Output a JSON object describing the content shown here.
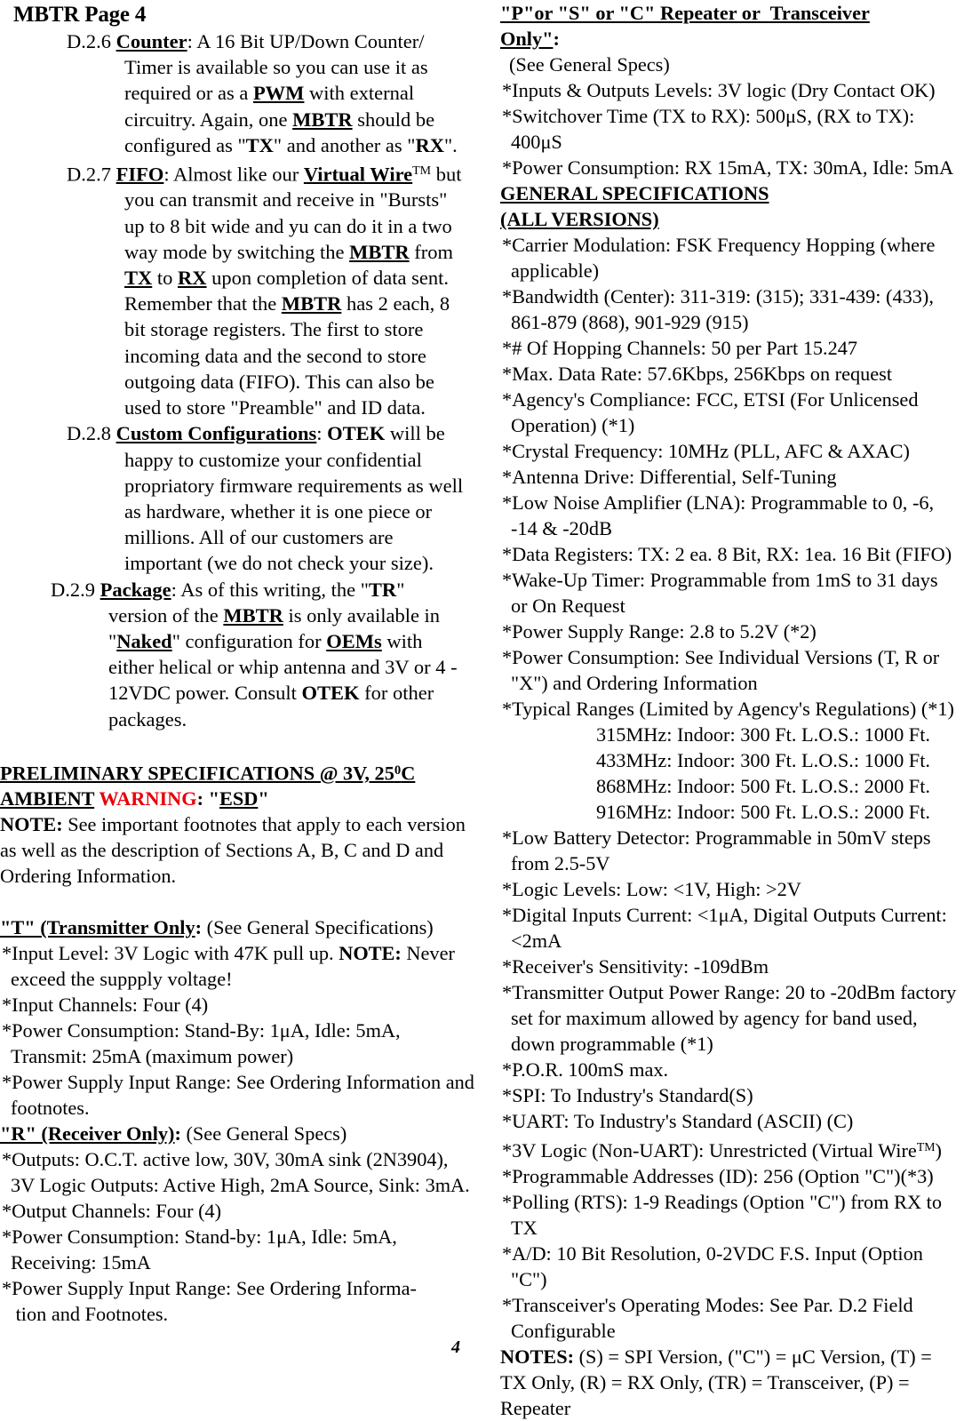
{
  "document": {
    "header": "MBTR Page 4",
    "page_number": "4",
    "warning_color": "#e8000a"
  },
  "left_column": {
    "paragraphs": [
      {
        "id": "D.2.6",
        "term": "Counter",
        "text": ": A 16 Bit UP/Down Counter/Timer is available so you can use it as required or as a PWM with external circuitry. Again, one MBTR should be configured as \"TX\" and another as \"RX\"."
      },
      {
        "id": "D.2.7",
        "term": "FIFO",
        "text": ": Almost like our Virtual Wire™ but you can transmit and receive in \"Bursts\" up to 8 bit wide and yu can do it in a two way mode by switching the MBTR from TX to RX upon completion of data sent. Remember that the MBTR has 2 each, 8 bit storage registers. The first to store incoming data and the second to store outgoing data (FIFO). This can also be used to store \"Preamble\" and ID data."
      },
      {
        "id": "D.2.8",
        "term": "Custom Configurations",
        "text": ": OTEK will be happy to customize your confidential propriatory firmware requirements as well as hardware, whether it is one piece or millions. All of our customers are important (we do not check your size)."
      },
      {
        "id": "D.2.9",
        "term": "Package",
        "text": ": As of this writing, the \"TR\" version of the MBTR is only available in \"Naked\" configuration for OEMs with either helical or whip antenna and 3V or 4 - 12VDC power. Consult OTEK for other packages."
      }
    ],
    "prelim": {
      "title_line1": "PRELIMINARY SPECIFICATIONS @ 3V, 250C",
      "title_line2_a": "AMBIENT ",
      "title_warning": "WARNING",
      "title_line2_b": ": \"ESD\"",
      "note_label": "NOTE:",
      "note_text": " See important footnotes that apply to each version as well as the description of Sections A, B, C and D and Ordering Information."
    },
    "transmitter": {
      "heading": "\"T\" (Transmitter Only: (See General Specifications)",
      "heading_bold": "\"T\" (Transmitter Only",
      "heading_rest": ": (See General Specifications)",
      "items": [
        "*Input Level: 3V Logic with 47K pull up. NOTE: Never exceed the suppply voltage!",
        "*Input Channels: Four (4)",
        "*Power Consumption: Stand-By: 1μA, Idle: 5mA, Transmit: 25mA (maximum power)",
        "*Power Supply Input Range: See Ordering Information and footnotes."
      ]
    },
    "receiver": {
      "heading_bold": "\"R\" (Receiver Only)",
      "heading_rest": ": (See General Specs)",
      "items": [
        "*Outputs: O.C.T. active low, 30V, 30mA sink (2N3904), 3V Logic Outputs: Active High, 2mA Source, Sink: 3mA.",
        "*Output Channels: Four (4)",
        "*Power Consumption: Stand-by: 1μA, Idle: 5mA, Receiving: 15mA",
        "*Power Supply Input Range: See Ordering Information and Footnotes."
      ]
    }
  },
  "right_column": {
    "repeater": {
      "heading_line1": "\"P\"or \"S\" or \"C\" Repeater or  Transceiver",
      "heading_line2": "Only\"",
      "heading_colon": ":",
      "subnote": " (See General Specs)",
      "items": [
        "*Inputs & Outputs Levels: 3V logic (Dry Contact OK)",
        "*Switchover Time (TX to RX): 500μS, (RX to TX): 400μS",
        "*Power Consumption: RX 15mA, TX: 30mA, Idle: 5mA"
      ]
    },
    "general": {
      "heading_line1": "GENERAL SPECIFICATIONS",
      "heading_line2": "(ALL VERSIONS)",
      "items": [
        "*Carrier Modulation: FSK Frequency Hopping (where applicable)",
        "*Bandwidth (Center): 311-319: (315); 331-439: (433), 861-879 (868), 901-929 (915)",
        "*# Of Hopping Channels: 50 per Part 15.247",
        "*Max. Data Rate: 57.6Kbps, 256Kbps on request",
        "*Agency's Compliance: FCC, ETSI (For Unlicensed Operation) (*1)",
        "*Crystal Frequency: 10MHz (PLL, AFC & AXAC)",
        "*Antenna Drive: Differential, Self-Tuning",
        "*Low Noise Amplifier (LNA): Programmable to 0, -6, -14 & -20dB",
        "*Data Registers: TX: 2 ea. 8 Bit, RX: 1ea. 16 Bit (FIFO)",
        "*Wake-Up Timer: Programmable from 1mS to 31 days or On Request",
        "*Power Supply Range: 2.8 to 5.2V (*2)",
        "*Power Consumption: See Individual Versions (T, R or \"X\") and Ordering Information",
        "*Typical Ranges (Limited by Agency's Regulations) (*1)"
      ],
      "ranges": [
        "315MHz: Indoor: 300 Ft. L.O.S.: 1000 Ft.",
        "433MHz: Indoor: 300 Ft. L.O.S.: 1000 Ft.",
        "868MHz: Indoor: 500 Ft. L.O.S.: 2000 Ft.",
        "916MHz: Indoor: 500 Ft. L.O.S.: 2000 Ft."
      ],
      "items2": [
        "*Low Battery Detector: Programmable in 50mV steps from 2.5-5V",
        "*Logic Levels: Low: <1V, High: >2V",
        "*Digital Inputs Current: <1μA, Digital Outputs Current: <2mA",
        "*Receiver's Sensitivity: -109dBm",
        "*Transmitter Output Power Range: 20 to -20dBm factory set for maximum allowed by agency for  band used, down programmable (*1)",
        "*P.O.R. 100mS max.",
        "*SPI: To Industry's Standard(S)",
        "*UART: To Industry's Standard (ASCII) (C)",
        "*3V Logic (Non-UART): Unrestricted (Virtual Wire™)",
        "*Programmable Addresses (ID): 256 (Option \"C\")(*3)",
        "*Polling (RTS): 1-9 Readings (Option \"C\") from RX to TX",
        "*A/D: 10 Bit Resolution, 0-2VDC F.S. Input (Option \"C\")",
        "*Transceiver's Operating Modes: See Par. D.2 Field Configurable"
      ],
      "notes_label": "NOTES:",
      "notes_text": " (S) = SPI Version, (\"C\") = μC Version, (T) = TX Only, (R) = RX Only, (TR) = Transceiver, (P) = Repeater"
    }
  }
}
